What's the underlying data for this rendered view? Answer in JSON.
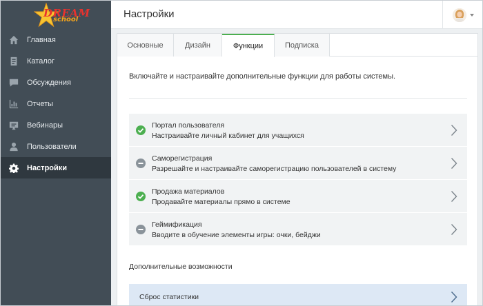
{
  "logo": {
    "text_main": "DREAM",
    "text_sub": "school"
  },
  "sidebar": {
    "items": [
      {
        "label": "Главная",
        "icon": "home-icon"
      },
      {
        "label": "Каталог",
        "icon": "catalog-icon"
      },
      {
        "label": "Обсуждения",
        "icon": "chat-icon"
      },
      {
        "label": "Отчеты",
        "icon": "chart-icon"
      },
      {
        "label": "Вебинары",
        "icon": "webinar-icon"
      },
      {
        "label": "Пользователи",
        "icon": "user-icon"
      },
      {
        "label": "Настройки",
        "icon": "gear-icon",
        "active": true
      }
    ]
  },
  "header": {
    "title": "Настройки"
  },
  "tabs": [
    {
      "label": "Основные"
    },
    {
      "label": "Дизайн"
    },
    {
      "label": "Функции",
      "active": true
    },
    {
      "label": "Подписка"
    }
  ],
  "main": {
    "intro": "Включайте и настраивайте дополнительные функции для работы системы.",
    "features": [
      {
        "title": "Портал пользователя",
        "description": "Настраивайте личный кабинет для учащихся",
        "enabled": true
      },
      {
        "title": "Саморегистрация",
        "description": "Разрешайте и настраивайте саморегистрацию пользователей в систему",
        "enabled": false
      },
      {
        "title": "Продажа материалов",
        "description": "Продавайте материалы прямо в системе",
        "enabled": true
      },
      {
        "title": "Геймификация",
        "description": "Вводите в обучение элементы игры: очки, бейджи",
        "enabled": false
      }
    ],
    "extra_title": "Дополнительные возможности",
    "reset_label": "Сброс статистики"
  },
  "colors": {
    "sidebar_bg": "#424d56",
    "sidebar_active": "#2f383f",
    "accent_green": "#4caf50",
    "disabled_gray": "#8a939a",
    "reset_bg": "#dde8f5"
  }
}
